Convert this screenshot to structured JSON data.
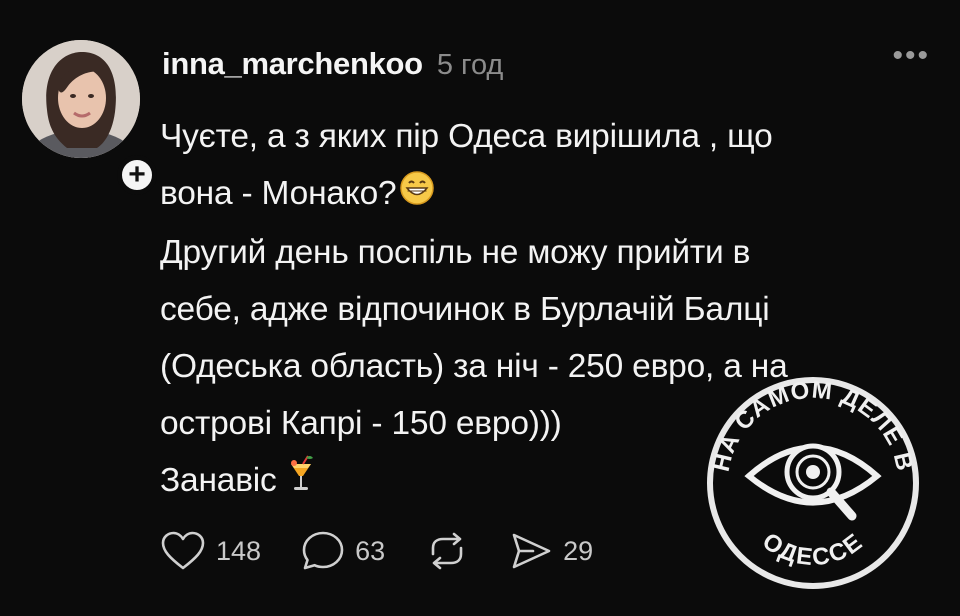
{
  "post": {
    "username": "inna_marchenkoo",
    "time": "5 год",
    "more_icon": "•••",
    "follow_icon": "+",
    "lines": [
      "Чуєте, а з яких пір Одеса вирішила , що",
      "вона - Монако?",
      "Другий день поспіль не можу прийти в",
      "себе, адже відпочинок в Бурлачій Балці",
      "(Одеська область) за ніч - 250 евро, а на",
      "острові Капрі - 150 евро)))",
      "Занавіс"
    ],
    "icons": {
      "grin": "grinning-face-icon",
      "cocktail": "tropical-drink-icon"
    }
  },
  "actions": {
    "likes": "148",
    "comments": "63",
    "repost_icon": "repost-icon",
    "shares": "29"
  },
  "watermark": {
    "top_text": "НА САМОМ ДЕЛЕ В",
    "bottom_text": "ОДЕССЕ"
  },
  "colors": {
    "background": "#0b0b0b",
    "text": "#f3f3f3",
    "muted": "#8c8c8c"
  }
}
